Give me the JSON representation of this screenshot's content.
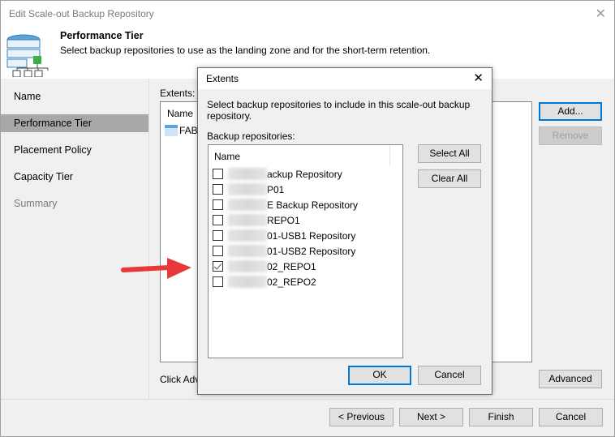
{
  "window": {
    "title": "Edit Scale-out Backup Repository",
    "close_icon": "close-icon"
  },
  "header": {
    "title": "Performance Tier",
    "subtitle": "Select backup repositories to use as the landing zone and for the short-term retention."
  },
  "sidebar": {
    "items": [
      {
        "label": "Name",
        "state": "normal"
      },
      {
        "label": "Performance Tier",
        "state": "active"
      },
      {
        "label": "Placement Policy",
        "state": "normal"
      },
      {
        "label": "Capacity Tier",
        "state": "normal"
      },
      {
        "label": "Summary",
        "state": "disabled"
      }
    ]
  },
  "content": {
    "extents_label": "Extents:",
    "list_header": "Name",
    "rows": [
      {
        "name": "FABT"
      }
    ],
    "add_button": "Add...",
    "remove_button": "Remove",
    "hint": "Click Adv",
    "advanced_button": "Advanced"
  },
  "footer": {
    "previous": "< Previous",
    "next": "Next >",
    "finish": "Finish",
    "cancel": "Cancel"
  },
  "dialog": {
    "title": "Extents",
    "description": "Select backup repositories to include in this scale-out backup repository.",
    "list_label": "Backup repositories:",
    "column_header": "Name",
    "select_all": "Select All",
    "clear_all": "Clear All",
    "ok": "OK",
    "cancel": "Cancel",
    "repositories": [
      {
        "name_visible": "ackup Repository",
        "checked": false
      },
      {
        "name_visible": "P01",
        "checked": false
      },
      {
        "name_visible": "E Backup Repository",
        "checked": false
      },
      {
        "name_visible": "REPO1",
        "checked": false
      },
      {
        "name_visible": "01-USB1 Repository",
        "checked": false
      },
      {
        "name_visible": "01-USB2 Repository",
        "checked": false
      },
      {
        "name_visible": "02_REPO1",
        "checked": true
      },
      {
        "name_visible": "02_REPO2",
        "checked": false
      }
    ]
  },
  "annotation": {
    "arrow_color": "#e8393a"
  }
}
